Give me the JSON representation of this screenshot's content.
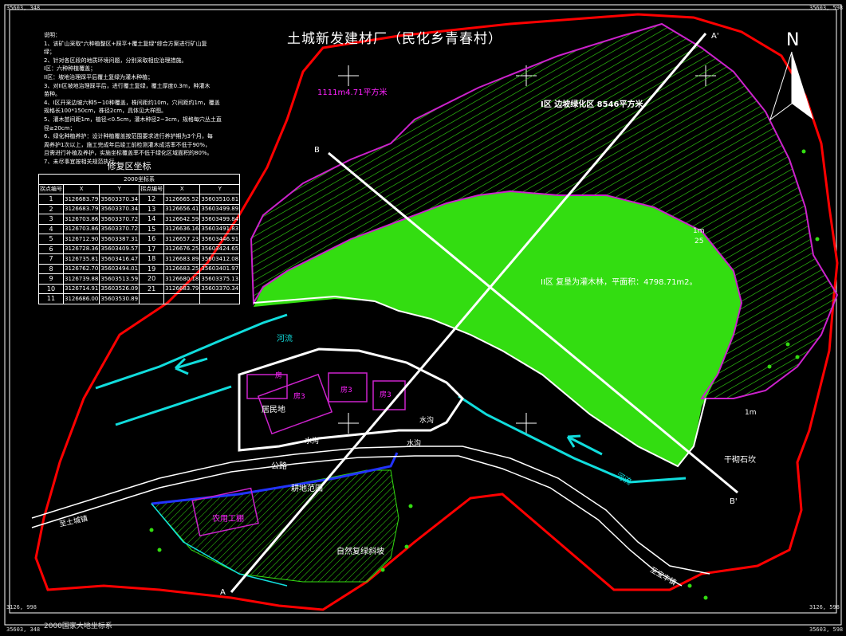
{
  "title": "土城新发建材厂（民化乡青春村）",
  "corners": {
    "top_left": "35603, 348",
    "top_right": "35603, 598",
    "bottom_left": "3126, 998",
    "bottom_right": "3126, 598",
    "bottom_left2": "35603, 348",
    "bottom_right2": "35603, 598"
  },
  "notes": [
    "说明：",
    "1、该矿山采取\"六种植整区+踩平+覆土复绿\"综合方案进行矿山复",
    "绿；",
    "2、针对各区段的地质环境问题，分别采取相应治理措施。",
    "   I区：六种种植覆盖；",
    "   II区：坡地治理踩平后覆土复绿为灌木种植；",
    "3、对II区坡地治理踩平后，进行覆土复绿，覆土厚度0.3m，种灌木",
    "苗种。",
    "4、I区开采边坡六种5~10种覆盖，株间距约10m，穴间距约1m，覆盖",
    "规格长100*150cm，株径2cm，具体见大样图。",
    "5、灌木苗间距1m，植径<0.5cm，灌木种径2~3cm，规格每穴丛土直",
    "径≥20cm；",
    "6、绿化种植养护：设计种植覆盖按范围要求进行养护期为3个月，每",
    "周养护1次以上，施工完成年后竣工前检测灌木成活率不低于90%，",
    "且需进行补植及养护，实施坐标覆盖率不低于绿化区域面积的80%。",
    "7、未尽事宜按相关规范执行。"
  ],
  "coord_table": {
    "title": "修复区坐标",
    "subtitle": "2000坐标系",
    "header": [
      "拐点编号",
      "X",
      "Y",
      "拐点编号",
      "X",
      "Y"
    ],
    "rows": [
      [
        "1",
        "3126683.79",
        "35603370.34",
        "12",
        "3126665.52",
        "35603510.81"
      ],
      [
        "2",
        "3126683.79",
        "35603370.34",
        "13",
        "3126656.41",
        "35603499.89"
      ],
      [
        "3",
        "3126703.86",
        "35603370.72",
        "14",
        "3126642.59",
        "35603499.84"
      ],
      [
        "4",
        "3126703.86",
        "35603370.72",
        "15",
        "3126636.16",
        "35603491.83"
      ],
      [
        "5",
        "3126712.90",
        "35603387.31",
        "16",
        "3126657.23",
        "35603446.91"
      ],
      [
        "6",
        "3126728.36",
        "35603409.57",
        "17",
        "3126676.25",
        "35603424.65"
      ],
      [
        "7",
        "3126735.81",
        "35603416.47",
        "18",
        "3126683.89",
        "35603412.08"
      ],
      [
        "8",
        "3126762.70",
        "35603494.01",
        "19",
        "3126683.25",
        "35603401.97"
      ],
      [
        "9",
        "3126739.88",
        "35603513.59",
        "20",
        "3126680.18",
        "35603375.13"
      ],
      [
        "10",
        "3126714.91",
        "35603526.09",
        "21",
        "3126683.79",
        "35603370.34"
      ],
      [
        "11",
        "3126686.00",
        "35603530.89",
        "",
        "",
        ""
      ]
    ]
  },
  "labels": {
    "zone1_area": "1111m4.71平方米",
    "zone1": "I区  边坡绿化区 8546平方米",
    "zone2": "II区  复垦为灌木林，平面积：4798.71m2。",
    "river1": "河流",
    "river2": "河流",
    "residential": "居民地",
    "canal1": "水沟",
    "canal2": "水沟",
    "canal3": "水沟",
    "road": "公路",
    "farmland": "耕地范围",
    "shed": "农用工棚",
    "slope": "自然复绿斜坡",
    "to_tucheng": "至土城镇",
    "to_x": "至宝丰镇",
    "quarry": "干砌石坎",
    "house_a": "房",
    "house_b": "房3",
    "house_c": "房3",
    "house_d": "房3",
    "north": "N",
    "section_a_top": "A'",
    "section_a_bottom": "A",
    "section_b_top": "B",
    "section_b_bottom": "B'",
    "one_m": "1m",
    "one_m2": "1m",
    "one_m3": "25"
  },
  "footer": "2000国家大地坐标系",
  "colors": {
    "boundary": "#ff0000",
    "zone_fill": "#33dd11",
    "hatch": "#33dd11",
    "river": "#11dddd",
    "residential": "#cc22cc",
    "road": "#ffffff",
    "farmland": "#2233ff",
    "zone1_label": "#ff22ff"
  }
}
